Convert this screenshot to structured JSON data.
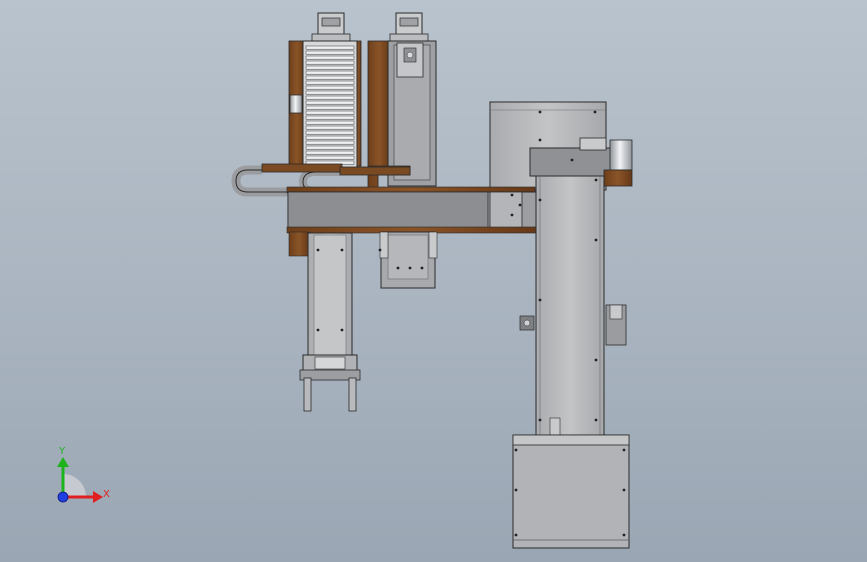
{
  "viewport": {
    "background_top": "#b9c3cd",
    "background_bottom": "#9aa6b3"
  },
  "palette": {
    "steel": "#b3b5b8",
    "steel_dark": "#8e9093",
    "steel_light": "#d0d2d4",
    "wood": "#7a4a22",
    "wood_dark": "#5a3414",
    "outline": "#2a2a2a",
    "chrome": "#e8eaec"
  },
  "triad": {
    "y_label": "Y",
    "x_label": "X",
    "y_color": "#1db31d",
    "x_color": "#e02020",
    "z_color": "#1f3fe0"
  }
}
